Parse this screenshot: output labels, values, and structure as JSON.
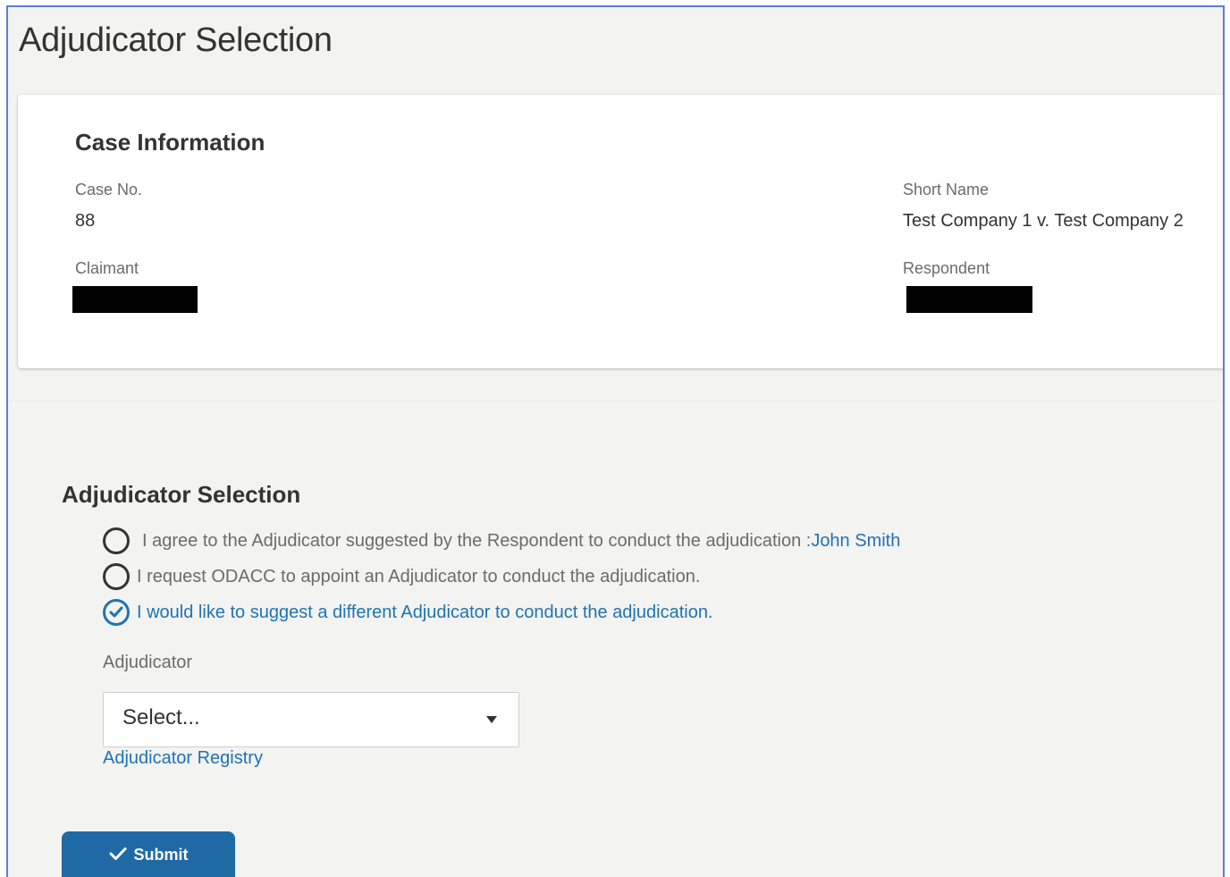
{
  "page": {
    "title": "Adjudicator Selection"
  },
  "case_info": {
    "title": "Case Information",
    "case_no_label": "Case No.",
    "case_no_value": "88",
    "short_name_label": "Short Name",
    "short_name_value": "Test Company 1 v. Test Company 2",
    "claimant_label": "Claimant",
    "respondent_label": "Respondent"
  },
  "selection": {
    "title": "Adjudicator Selection",
    "options": [
      {
        "label": "I agree to the Adjudicator suggested by the Respondent to conduct the adjudication : ",
        "link": "John Smith",
        "selected": false
      },
      {
        "label": "I request ODACC to appoint an Adjudicator to conduct the adjudication.",
        "selected": false
      },
      {
        "label": "I would like to suggest a different Adjudicator to conduct the adjudication.",
        "selected": true
      }
    ],
    "adjudicator_label": "Adjudicator",
    "adjudicator_select_value": "Select...",
    "registry_link": "Adjudicator Registry"
  },
  "actions": {
    "submit_label": "Submit"
  },
  "colors": {
    "accent": "#1e73b5",
    "button": "#1f6aa5",
    "background": "#f3f3f1",
    "frame_border": "#5b7fd6"
  },
  "icons": {
    "submit": "check-icon",
    "select": "caret-down-icon",
    "selected_radio": "check-circle-icon"
  }
}
